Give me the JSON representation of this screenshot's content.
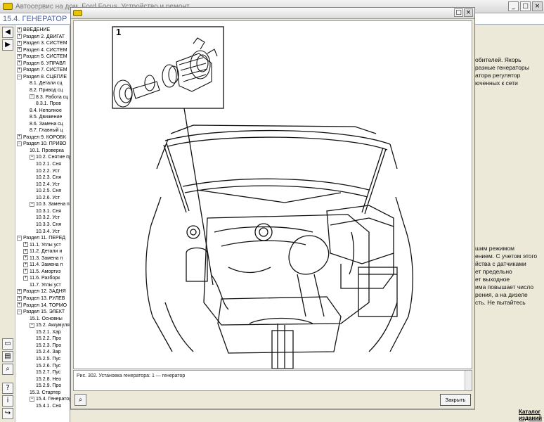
{
  "window": {
    "title": "Автосервис на дом. Ford Focus. Устройство и ремонт",
    "min_icon": "minimize-icon",
    "max_icon": "maximize-icon",
    "close_icon": "close-icon"
  },
  "header": {
    "section_title": "15.4. ГЕНЕРАТОР"
  },
  "toolbar": {
    "top": [
      "back-arrow-icon",
      "forward-arrow-icon"
    ],
    "bottom": [
      "print-preview-icon",
      "print-icon",
      "zoom-icon",
      "help-icon",
      "info-icon",
      "exit-icon"
    ]
  },
  "tree": [
    {
      "sign": "+",
      "label": "ВВЕДЕНИЕ",
      "indent": 0
    },
    {
      "sign": "+",
      "label": "Раздел 2. ДВИГАТ",
      "indent": 0
    },
    {
      "sign": "+",
      "label": "Раздел 3. СИСТЕМ",
      "indent": 0
    },
    {
      "sign": "+",
      "label": "Раздел 4. СИСТЕМ",
      "indent": 0
    },
    {
      "sign": "+",
      "label": "Раздел 5. СИСТЕМ",
      "indent": 0
    },
    {
      "sign": "+",
      "label": "Раздел 6. УПРАВЛ",
      "indent": 0
    },
    {
      "sign": "+",
      "label": "Раздел 7. СИСТЕМ",
      "indent": 0
    },
    {
      "sign": "−",
      "label": "Раздел 8. СЦЕПЛЕ",
      "indent": 0
    },
    {
      "sign": "",
      "label": "8.1. Детали сц",
      "indent": 2
    },
    {
      "sign": "",
      "label": "8.2. Привод сц",
      "indent": 2
    },
    {
      "sign": "−",
      "label": "8.3. Работа сц",
      "indent": 2
    },
    {
      "sign": "",
      "label": "8.3.1. Пров",
      "indent": 3
    },
    {
      "sign": "",
      "label": "8.4. Неполное",
      "indent": 2
    },
    {
      "sign": "",
      "label": "8.5. Движение",
      "indent": 2
    },
    {
      "sign": "",
      "label": "8.6. Замена сц",
      "indent": 2
    },
    {
      "sign": "",
      "label": "8.7. Главный ц",
      "indent": 2
    },
    {
      "sign": "+",
      "label": "Раздел 9. КОРОБК",
      "indent": 0
    },
    {
      "sign": "−",
      "label": "Раздел 10. ПРИВО",
      "indent": 0
    },
    {
      "sign": "",
      "label": "10.1. Проверка",
      "indent": 2
    },
    {
      "sign": "−",
      "label": "10.2. Снятие пр",
      "indent": 2
    },
    {
      "sign": "",
      "label": "10.2.1. Сня",
      "indent": 3
    },
    {
      "sign": "",
      "label": "10.2.2. Уст",
      "indent": 3
    },
    {
      "sign": "",
      "label": "10.2.3. Сня",
      "indent": 3
    },
    {
      "sign": "",
      "label": "10.2.4. Уст",
      "indent": 3
    },
    {
      "sign": "",
      "label": "10.2.5. Сня",
      "indent": 3
    },
    {
      "sign": "",
      "label": "10.2.6. Уст",
      "indent": 3
    },
    {
      "sign": "−",
      "label": "10.3. Замена пр",
      "indent": 2
    },
    {
      "sign": "",
      "label": "10.3.1. Сня",
      "indent": 3
    },
    {
      "sign": "",
      "label": "10.3.2. Уст",
      "indent": 3
    },
    {
      "sign": "",
      "label": "10.3.3. Сня",
      "indent": 3
    },
    {
      "sign": "",
      "label": "10.3.4. Уст",
      "indent": 3
    },
    {
      "sign": "−",
      "label": "Раздел 11. ПЕРЕД",
      "indent": 0
    },
    {
      "sign": "+",
      "label": "11.1. Углы уст",
      "indent": 1
    },
    {
      "sign": "+",
      "label": "11.2. Детали и",
      "indent": 1
    },
    {
      "sign": "+",
      "label": "11.3. Замена п",
      "indent": 1
    },
    {
      "sign": "+",
      "label": "11.4. Замена п",
      "indent": 1
    },
    {
      "sign": "+",
      "label": "11.5. Амортиз",
      "indent": 1
    },
    {
      "sign": "+",
      "label": "11.6. Разборк",
      "indent": 1
    },
    {
      "sign": "",
      "label": "11.7. Углы уст",
      "indent": 2
    },
    {
      "sign": "+",
      "label": "Раздел 12. ЗАДНЯ",
      "indent": 0
    },
    {
      "sign": "+",
      "label": "Раздел 13. РУЛЕВ",
      "indent": 0
    },
    {
      "sign": "+",
      "label": "Раздел 14. ТОРМО",
      "indent": 0
    },
    {
      "sign": "−",
      "label": "Раздел 15. ЭЛЕКТ",
      "indent": 0
    },
    {
      "sign": "",
      "label": "15.1. Основны",
      "indent": 2
    },
    {
      "sign": "−",
      "label": "15.2. Аккумуля",
      "indent": 2
    },
    {
      "sign": "",
      "label": "15.2.1. Хар",
      "indent": 3
    },
    {
      "sign": "",
      "label": "15.2.2. Про",
      "indent": 3
    },
    {
      "sign": "",
      "label": "15.2.3. Про",
      "indent": 3
    },
    {
      "sign": "",
      "label": "15.2.4. Зар",
      "indent": 3
    },
    {
      "sign": "",
      "label": "15.2.5. Пус",
      "indent": 3
    },
    {
      "sign": "",
      "label": "15.2.6. Пус",
      "indent": 3
    },
    {
      "sign": "",
      "label": "15.2.7. Пус",
      "indent": 3
    },
    {
      "sign": "",
      "label": "15.2.8. Нео",
      "indent": 3
    },
    {
      "sign": "",
      "label": "15.2.9. Про",
      "indent": 3
    },
    {
      "sign": "",
      "label": "15.3. Стартер",
      "indent": 2
    },
    {
      "sign": "−",
      "label": "15.4. Генератор",
      "indent": 2
    },
    {
      "sign": "",
      "label": "15.4.1. Сня",
      "indent": 3
    }
  ],
  "background_text": {
    "block1": [
      "обителей. Якорь",
      "разные генераторы",
      "атора регулятор",
      "юченных к сети"
    ],
    "block2": [
      "шим режимом",
      "ением. С учетом этого",
      "йства с датчиками",
      "ет предельно",
      "ет выходное",
      "има повышает число",
      "рения, а на дизеле",
      "сть. Не пытайтесь"
    ]
  },
  "catalog_link": [
    "Каталог",
    "изданий"
  ],
  "popup": {
    "figure_label": "1",
    "caption": "Рис. 302. Установка генератора: 1 — генератор",
    "close_label": "Закрыть"
  }
}
